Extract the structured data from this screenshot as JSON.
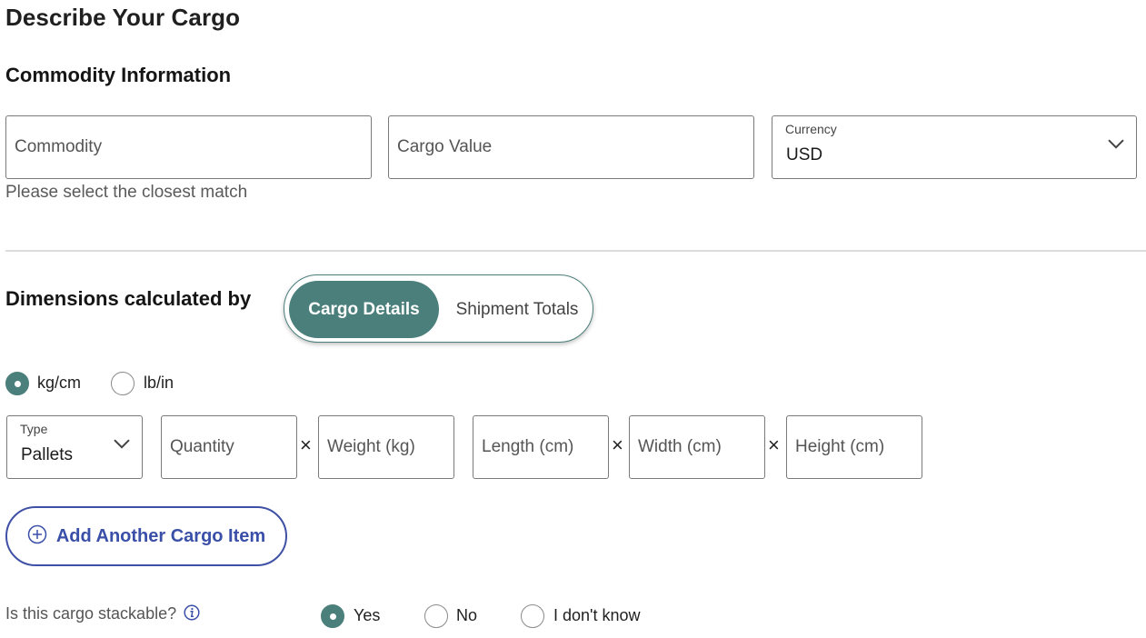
{
  "page": {
    "title": "Describe Your Cargo"
  },
  "commodity_section": {
    "heading": "Commodity Information",
    "commodity": {
      "placeholder": "Commodity",
      "helper": "Please select the closest match"
    },
    "cargo_value": {
      "placeholder": "Cargo Value"
    },
    "currency": {
      "label": "Currency",
      "value": "USD",
      "icon": "chevron-down-icon"
    }
  },
  "dimensions": {
    "heading": "Dimensions calculated by",
    "toggle": {
      "options": [
        "Cargo Details",
        "Shipment Totals"
      ],
      "selected": "Cargo Details"
    },
    "units": {
      "options": [
        "kg/cm",
        "lb/in"
      ],
      "selected": "kg/cm"
    },
    "row": {
      "type": {
        "label": "Type",
        "value": "Pallets"
      },
      "quantity": {
        "placeholder": "Quantity"
      },
      "weight": {
        "placeholder": "Weight (kg)"
      },
      "length": {
        "placeholder": "Length (cm)"
      },
      "width": {
        "placeholder": "Width (cm)"
      },
      "height": {
        "placeholder": "Height (cm)"
      },
      "times_symbol": "×"
    },
    "add_button": {
      "label": "Add Another Cargo Item",
      "icon": "plus-circle-icon"
    }
  },
  "stackable": {
    "question": "Is this cargo stackable?",
    "info_icon": "info-icon",
    "options": [
      "Yes",
      "No",
      "I don't know"
    ],
    "selected": "Yes"
  },
  "colors": {
    "accent": "#4b7f7b",
    "link": "#3a4fa8",
    "border": "#7a7a7a"
  }
}
